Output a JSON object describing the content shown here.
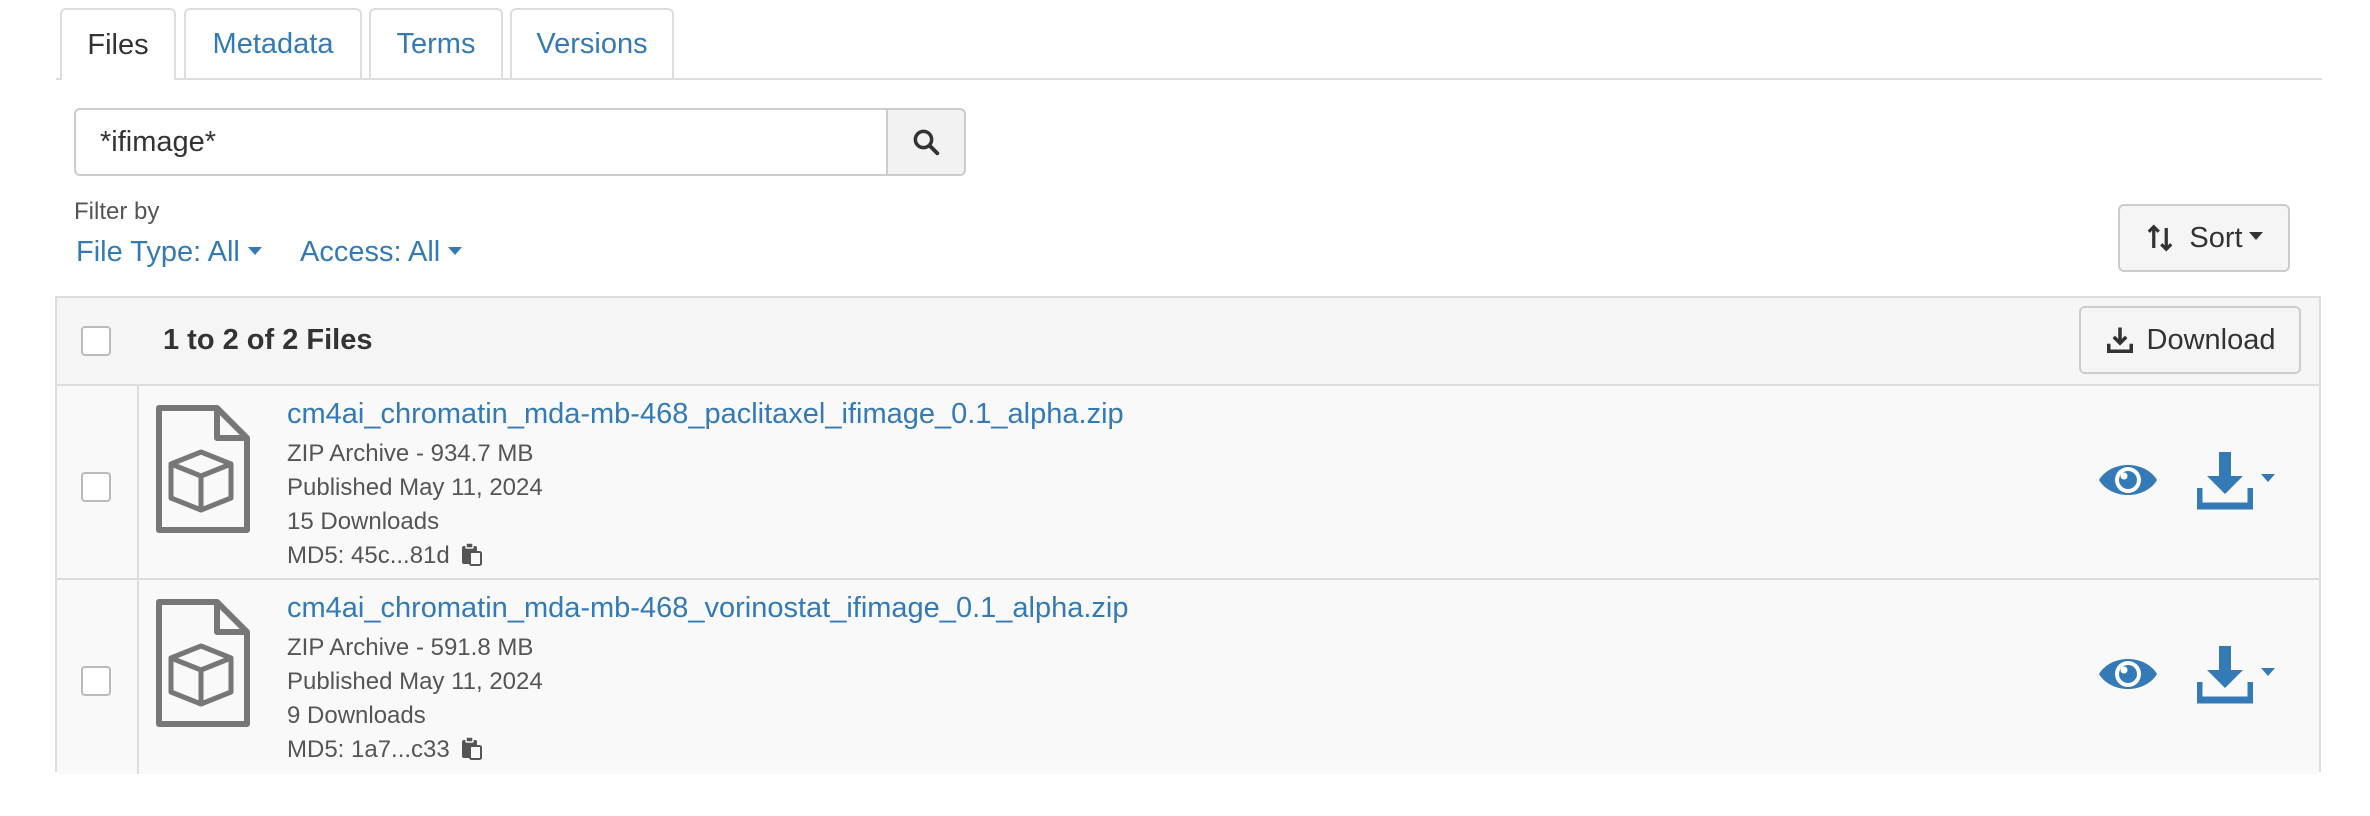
{
  "tabs": [
    {
      "label": "Files",
      "active": true
    },
    {
      "label": "Metadata",
      "active": false
    },
    {
      "label": "Terms",
      "active": false
    },
    {
      "label": "Versions",
      "active": false
    }
  ],
  "search": {
    "value": "*ifimage*",
    "icon": "search-icon"
  },
  "filters": {
    "label": "Filter by",
    "file_type": "File Type: All",
    "access": "Access: All"
  },
  "sort": {
    "label": "Sort",
    "icon": "sort-icon"
  },
  "table": {
    "count_label": "1 to 2 of 2 Files",
    "download_label": "Download",
    "files": [
      {
        "name": "cm4ai_chromatin_mda-mb-468_paclitaxel_ifimage_0.1_alpha.zip",
        "type_size": "ZIP Archive - 934.7 MB",
        "published": "Published May 11, 2024",
        "downloads": "15 Downloads",
        "md5": "MD5: 45c...81d"
      },
      {
        "name": "cm4ai_chromatin_mda-mb-468_vorinostat_ifimage_0.1_alpha.zip",
        "type_size": "ZIP Archive - 591.8 MB",
        "published": "Published May 11, 2024",
        "downloads": "9 Downloads",
        "md5": "MD5: 1a7...c33"
      }
    ]
  },
  "colors": {
    "link": "#337ab7",
    "text": "#333333",
    "muted": "#555555",
    "border": "#dddddd",
    "icon_gray": "#777777"
  }
}
